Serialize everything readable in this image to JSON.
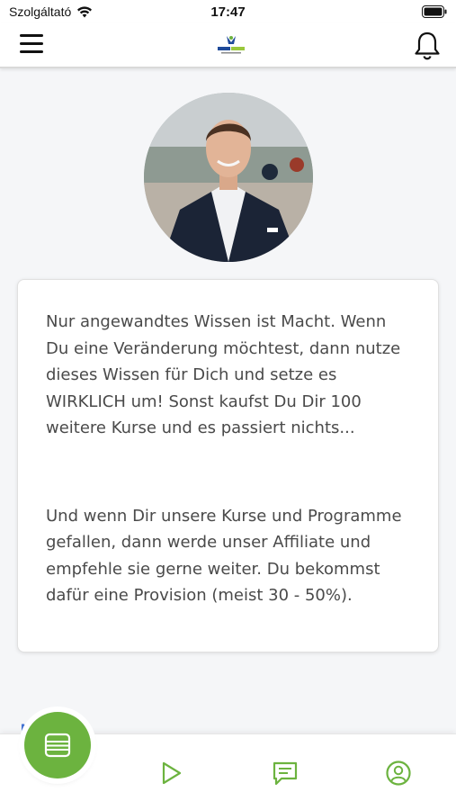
{
  "status_bar": {
    "carrier": "Szolgáltató",
    "time": "17:47",
    "wifi_icon": "wifi-icon",
    "battery_icon": "battery-icon"
  },
  "header": {
    "menu_icon": "hamburger-menu-icon",
    "logo_icon": "app-logo",
    "bell_icon": "bell-icon"
  },
  "card": {
    "paragraph_1": "Nur angewandtes Wissen ist Macht. Wenn\nDu eine Veränderung möchtest, dann nutze\ndieses Wissen für Dich und setze es\nWIRKLICH um! Sonst kaufst Du Dir 100\nweitere Kurse und es passiert nichts...",
    "paragraph_2": "Und wenn Dir unsere Kurse und Programme\ngefallen, dann werde unser Affiliate und\nempfehle sie gerne weiter. Du bekommst\ndafür eine Provision (meist 30 - 50%)."
  },
  "section_title": "Mein K",
  "bottom_nav": {
    "items": [
      {
        "icon": "courses-list-icon",
        "active": true
      },
      {
        "icon": "play-icon"
      },
      {
        "icon": "chat-icon"
      },
      {
        "icon": "profile-icon"
      }
    ]
  },
  "colors": {
    "accent_green": "#6cb33f",
    "link_blue": "#3f6fd1",
    "text": "#4a4a4a"
  }
}
